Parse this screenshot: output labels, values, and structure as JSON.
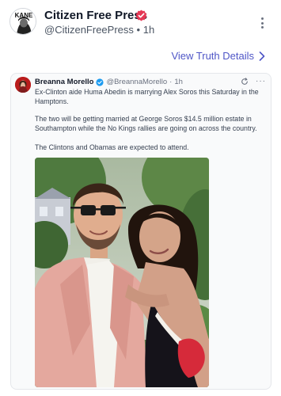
{
  "post": {
    "display_name": "Citizen Free Press",
    "handle": "@CitizenFreePress",
    "time": "1h",
    "separator": "•",
    "avatar_text": "KANE"
  },
  "view_details": {
    "label": "View Truth Details"
  },
  "quoted": {
    "name": "Breanna Morello",
    "handle": "@BreannaMorello",
    "time": "1h",
    "separator": "·",
    "paragraphs": [
      "Ex-Clinton aide Huma Abedin is marrying Alex Soros this Saturday in the Hamptons.",
      "The two will be getting married at George Soros $14.5 million estate in Southampton while the No Kings rallies are going on across the country.",
      "The Clintons and Obamas are expected to attend."
    ]
  },
  "icons": {
    "verified": "verified-badge-icon",
    "kebab": "vertical-ellipsis-icon",
    "chevron": "chevron-right-icon",
    "refresh": "refresh-icon",
    "more": "horizontal-ellipsis-icon"
  },
  "colors": {
    "accent": "#4f56c7",
    "verified_badge": "#e53955",
    "card_verified": "#1d9bf0"
  }
}
